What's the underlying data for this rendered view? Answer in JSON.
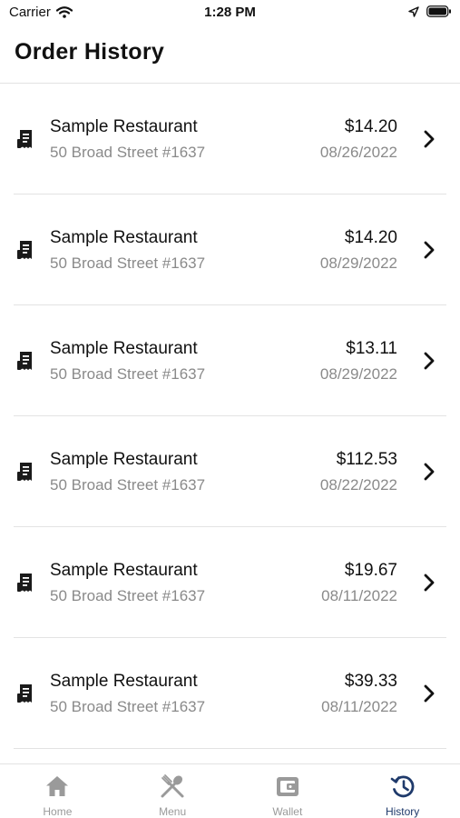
{
  "status_bar": {
    "carrier": "Carrier",
    "time": "1:28 PM"
  },
  "header": {
    "title": "Order History"
  },
  "orders": [
    {
      "restaurant": "Sample Restaurant",
      "address": "50 Broad Street #1637",
      "price": "$14.20",
      "date": "08/26/2022"
    },
    {
      "restaurant": "Sample Restaurant",
      "address": "50 Broad Street #1637",
      "price": "$14.20",
      "date": "08/29/2022"
    },
    {
      "restaurant": "Sample Restaurant",
      "address": "50 Broad Street #1637",
      "price": "$13.11",
      "date": "08/29/2022"
    },
    {
      "restaurant": "Sample Restaurant",
      "address": "50 Broad Street #1637",
      "price": "$112.53",
      "date": "08/22/2022"
    },
    {
      "restaurant": "Sample Restaurant",
      "address": "50 Broad Street #1637",
      "price": "$19.67",
      "date": "08/11/2022"
    },
    {
      "restaurant": "Sample Restaurant",
      "address": "50 Broad Street #1637",
      "price": "$39.33",
      "date": "08/11/2022"
    }
  ],
  "tabs": [
    {
      "label": "Home",
      "icon": "home-icon",
      "active": false
    },
    {
      "label": "Menu",
      "icon": "utensils-icon",
      "active": false
    },
    {
      "label": "Wallet",
      "icon": "wallet-icon",
      "active": false
    },
    {
      "label": "History",
      "icon": "history-icon",
      "active": true
    }
  ],
  "colors": {
    "active_tab": "#1f3a6b",
    "inactive_tab": "#9a9a9a",
    "secondary_text": "#8a8a8a",
    "divider": "#e3e3e3"
  }
}
